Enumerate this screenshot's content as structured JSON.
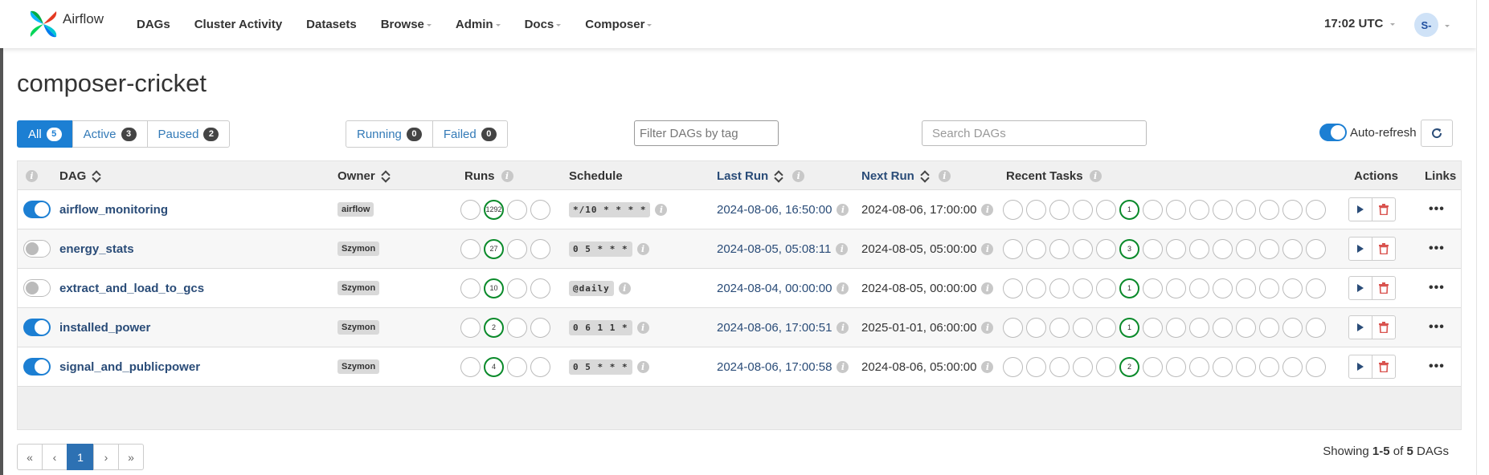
{
  "nav": {
    "brand": "Airflow",
    "items": [
      {
        "label": "DAGs",
        "dropdown": false
      },
      {
        "label": "Cluster Activity",
        "dropdown": false
      },
      {
        "label": "Datasets",
        "dropdown": false
      },
      {
        "label": "Browse",
        "dropdown": true
      },
      {
        "label": "Admin",
        "dropdown": true
      },
      {
        "label": "Docs",
        "dropdown": true
      },
      {
        "label": "Composer",
        "dropdown": true
      }
    ],
    "time": "17:02 UTC",
    "user_initials": "S-"
  },
  "page": {
    "title": "composer-cricket"
  },
  "filters": {
    "status": [
      {
        "label": "All",
        "count": "5",
        "active": true
      },
      {
        "label": "Active",
        "count": "3",
        "active": false
      },
      {
        "label": "Paused",
        "count": "2",
        "active": false
      }
    ],
    "run_state": [
      {
        "label": "Running",
        "count": "0"
      },
      {
        "label": "Failed",
        "count": "0"
      }
    ],
    "tag_placeholder": "Filter DAGs by tag",
    "search_placeholder": "Search DAGs",
    "autorefresh_label": "Auto-refresh",
    "autorefresh_on": true
  },
  "table": {
    "headers": {
      "dag": "DAG",
      "owner": "Owner",
      "runs": "Runs",
      "schedule": "Schedule",
      "last_run": "Last Run",
      "next_run": "Next Run",
      "recent_tasks": "Recent Tasks",
      "actions": "Actions",
      "links": "Links"
    },
    "rows": [
      {
        "dag": "airflow_monitoring",
        "active": true,
        "owner": "airflow",
        "runs_success": "1292",
        "schedule": "*/10 * * * *",
        "last_run": "2024-08-06, 16:50:00",
        "next_run": "2024-08-06, 17:00:00",
        "tasks_success": "1"
      },
      {
        "dag": "energy_stats",
        "active": false,
        "owner": "Szymon",
        "runs_success": "27",
        "schedule": "0 5 * * *",
        "last_run": "2024-08-05, 05:08:11",
        "next_run": "2024-08-05, 05:00:00",
        "tasks_success": "3"
      },
      {
        "dag": "extract_and_load_to_gcs",
        "active": false,
        "owner": "Szymon",
        "runs_success": "10",
        "schedule": "@daily",
        "last_run": "2024-08-04, 00:00:00",
        "next_run": "2024-08-05, 00:00:00",
        "tasks_success": "1"
      },
      {
        "dag": "installed_power",
        "active": true,
        "owner": "Szymon",
        "runs_success": "2",
        "schedule": "0 6 1 1 *",
        "last_run": "2024-08-06, 17:00:51",
        "next_run": "2025-01-01, 06:00:00",
        "tasks_success": "1"
      },
      {
        "dag": "signal_and_publicpower",
        "active": true,
        "owner": "Szymon",
        "runs_success": "4",
        "schedule": "0 5 * * *",
        "last_run": "2024-08-06, 17:00:58",
        "next_run": "2024-08-06, 05:00:00",
        "tasks_success": "2"
      }
    ]
  },
  "pagination": {
    "first": "«",
    "prev": "‹",
    "current": "1",
    "next": "›",
    "last": "»"
  },
  "showing": {
    "prefix": "Showing",
    "range": "1-5",
    "of": "of",
    "total": "5",
    "suffix": "DAGs"
  },
  "colors": {
    "primary": "#1c7fd3",
    "success_ring": "#0a8a2a",
    "link": "#2a4c78",
    "danger": "#d9534f"
  }
}
